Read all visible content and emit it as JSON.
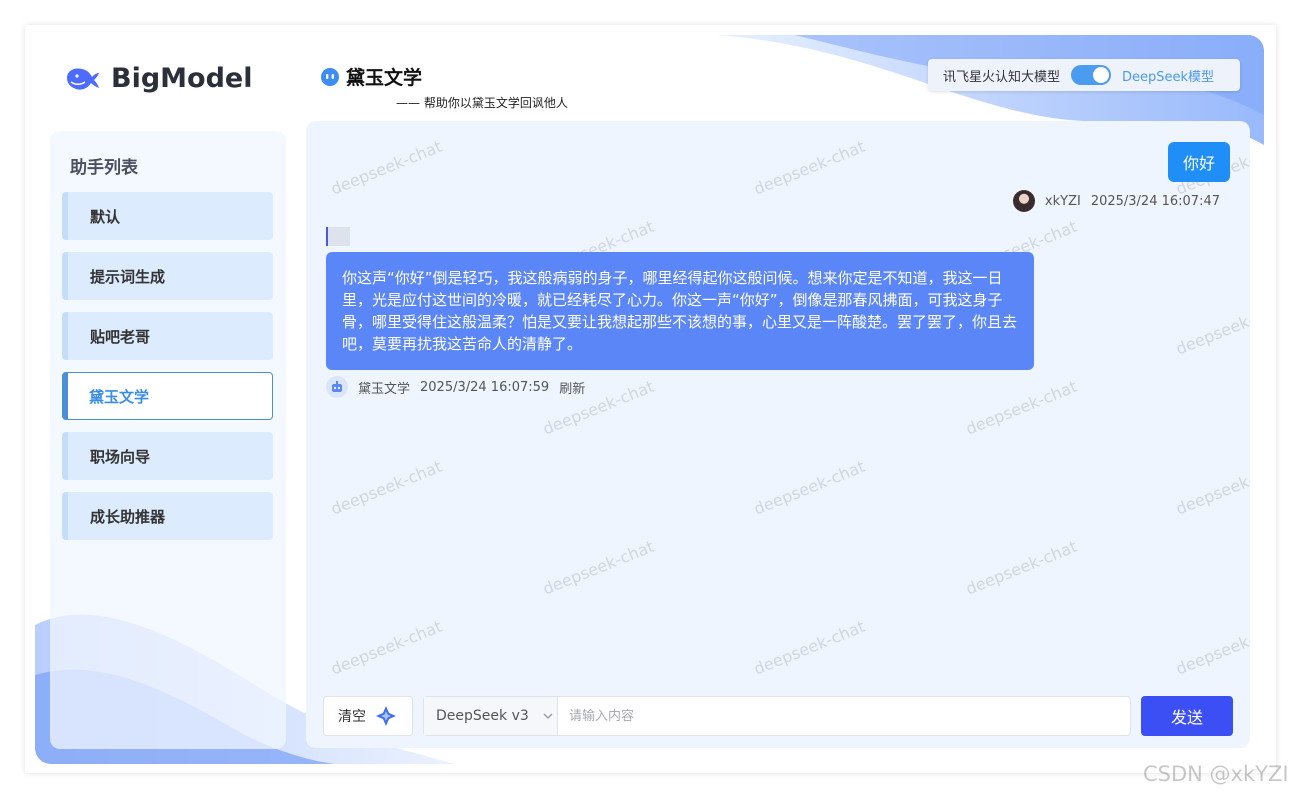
{
  "brand": {
    "name": "BigModel",
    "logo_icon": "whale-icon",
    "accent": "#4d6bfe"
  },
  "sidebar": {
    "title": "助手列表",
    "items": [
      {
        "label": "默认",
        "active": false
      },
      {
        "label": "提示词生成",
        "active": false
      },
      {
        "label": "贴吧老哥",
        "active": false
      },
      {
        "label": "黛玉文学",
        "active": true
      },
      {
        "label": "职场向导",
        "active": false
      },
      {
        "label": "成长助推器",
        "active": false
      }
    ]
  },
  "header": {
    "icon": "robot-icon",
    "title": "黛玉文学",
    "subtitle": "—— 帮助你以黛玉文学回讽他人",
    "model_switch": {
      "left_label": "讯飞星火认知大模型",
      "right_label": "DeepSeek模型",
      "selected": "DeepSeek模型"
    }
  },
  "chat": {
    "watermark": "deepseek-chat",
    "messages": [
      {
        "role": "user",
        "text": "你好",
        "author": "xkYZI",
        "time": "2025/3/24 16:07:47"
      },
      {
        "role": "assistant",
        "text": "你这声“你好”倒是轻巧，我这般病弱的身子，哪里经得起你这般问候。想来你定是不知道，我这一日里，光是应付这世间的冷暖，就已经耗尽了心力。你这一声“你好”，倒像是那春风拂面，可我这身子骨，哪里受得住这般温柔？怕是又要让我想起那些不该想的事，心里又是一阵酸楚。罢了罢了，你且去吧，莫要再扰我这苦命人的清静了。",
        "author": "黛玉文学",
        "time": "2025/3/24 16:07:59",
        "action": "刷新"
      }
    ]
  },
  "composer": {
    "clear_label": "清空",
    "clear_icon": "sparkle-icon",
    "model": "DeepSeek v3",
    "placeholder": "请输入内容",
    "send_label": "发送"
  },
  "page_watermark": "CSDN @xkYZI",
  "colors": {
    "user_bubble": "#1f8ef7",
    "ai_bubble": "#5b86f7",
    "send_button": "#3b4ff5",
    "panel_bg": "#eef5fe"
  }
}
